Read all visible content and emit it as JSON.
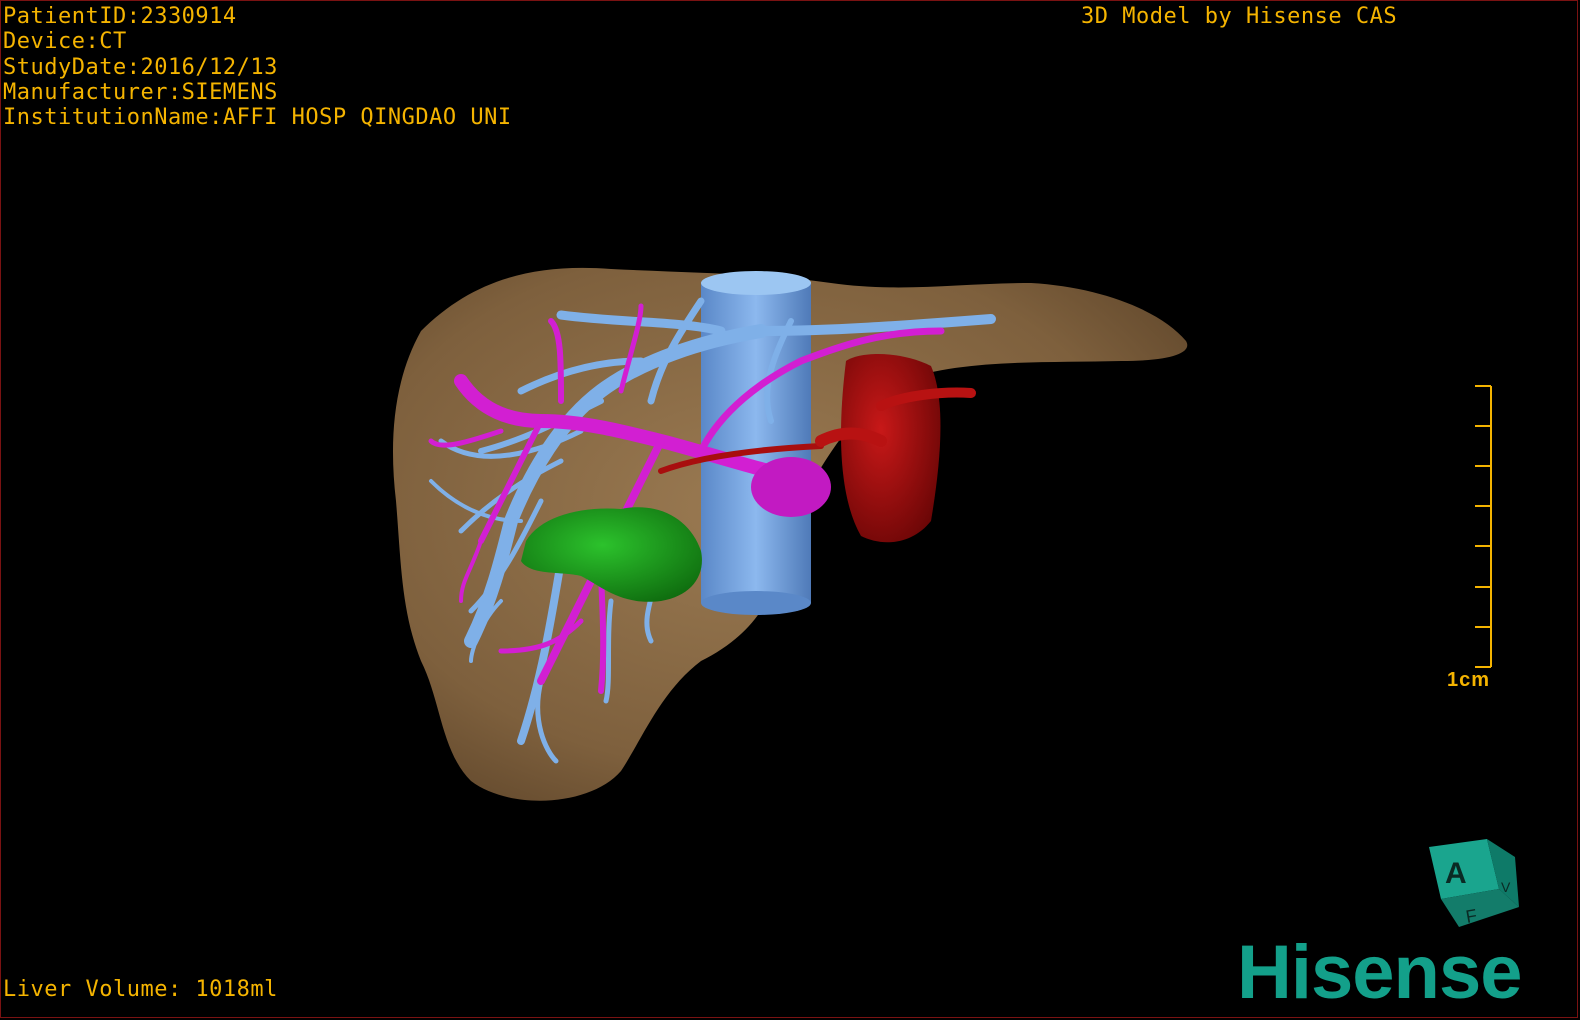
{
  "overlay": {
    "patient_id": "PatientID:2330914",
    "device": "Device:CT",
    "study_date": "StudyDate:2016/12/13",
    "manufacturer": "Manufacturer:SIEMENS",
    "institution": "InstitutionName:AFFI HOSP QINGDAO UNI",
    "credit": "3D Model by Hisense CAS",
    "liver_volume": "Liver Volume: 1018ml"
  },
  "scale": {
    "label": "1cm"
  },
  "orientation_cube": {
    "front_label": "A",
    "bottom_label": "F",
    "side_label": "V"
  },
  "brand": {
    "logo_text": "Hisense",
    "color": "#13a08a"
  },
  "colors": {
    "text": "#f5b400",
    "liver": "#8a6a45",
    "hepatic_vein": "#7fb0e8",
    "portal_vein": "#d21fd2",
    "artery": "#b01010",
    "lesion": "#1c9e1c",
    "border": "#7a1212"
  },
  "icons": {
    "scale": "ruler-icon",
    "cube": "orientation-cube-icon"
  }
}
